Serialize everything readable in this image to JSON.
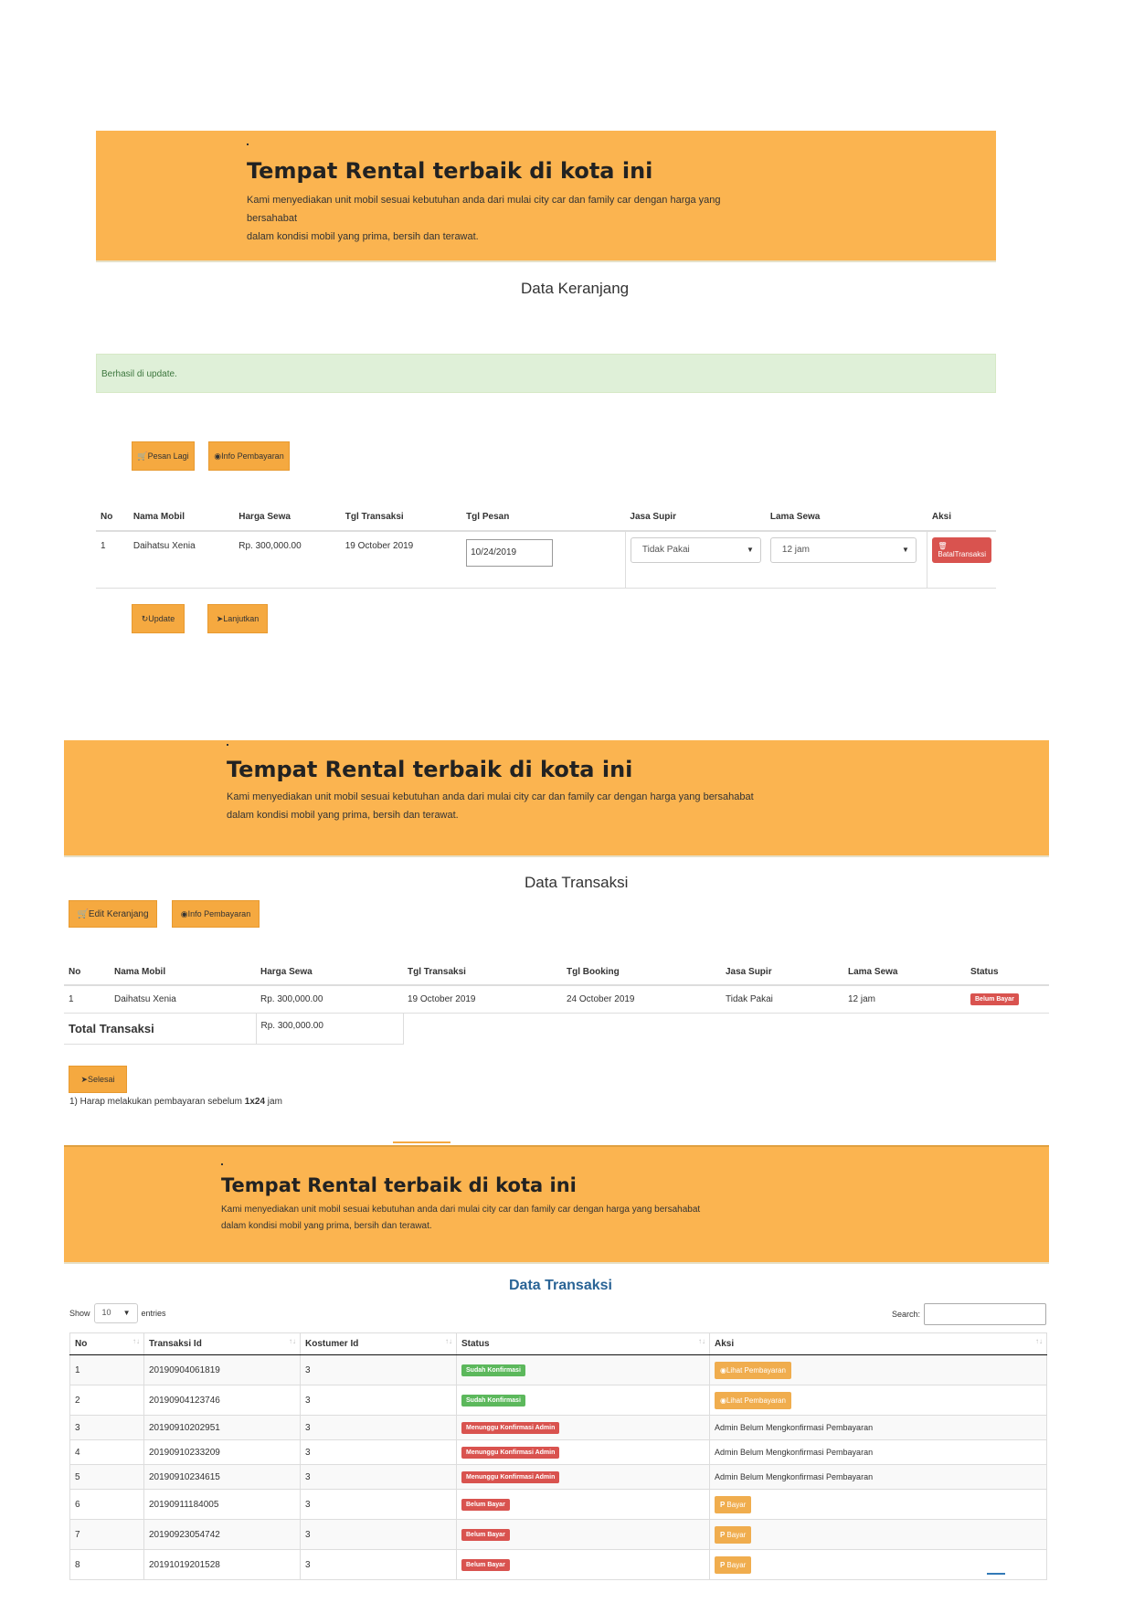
{
  "jumbotron": {
    "title": "Tempat Rental terbaik di kota ini",
    "line1": "Kami menyediakan unit mobil sesuai kebutuhan anda dari mulai city car dan family car dengan harga yang bersahabat",
    "line2": "dalam kondisi mobil yang prima, bersih dan terawat."
  },
  "cart": {
    "title": "Data Keranjang",
    "alert": "Berhasil di update.",
    "buttons": {
      "pesan_lagi": "Pesan Lagi",
      "info_pembayaran": "Info Pembayaran",
      "update": "Update",
      "lanjutkan": "Lanjutkan"
    },
    "columns": [
      "No",
      "Nama Mobil",
      "Harga Sewa",
      "Tgl Transaksi",
      "Tgl Pesan",
      "Jasa Supir",
      "Lama Sewa",
      "Aksi"
    ],
    "row": {
      "no": "1",
      "nama_mobil": "Daihatsu Xenia",
      "harga_sewa": "Rp. 300,000.00",
      "tgl_transaksi": "19 October 2019",
      "tgl_pesan": "10/24/2019",
      "jasa_supir": "Tidak Pakai",
      "lama_sewa": "12 jam",
      "aksi": "BatalTransaksi"
    }
  },
  "transaksi": {
    "title": "Data Transaksi",
    "buttons": {
      "edit_keranjang": "Edit Keranjang",
      "info_pembayaran": "Info Pembayaran",
      "selesai": "Selesai"
    },
    "columns": [
      "No",
      "Nama Mobil",
      "Harga Sewa",
      "Tgl Transaksi",
      "Tgl Booking",
      "Jasa Supir",
      "Lama Sewa",
      "Status"
    ],
    "row": {
      "no": "1",
      "nama_mobil": "Daihatsu Xenia",
      "harga_sewa": "Rp. 300,000.00",
      "tgl_transaksi": "19 October 2019",
      "tgl_booking": "24 October 2019",
      "jasa_supir": "Tidak Pakai",
      "lama_sewa": "12 jam",
      "status": "Belum Bayar"
    },
    "total_label": "Total Transaksi",
    "total_value": "Rp. 300,000.00",
    "note_prefix": "1) Harap melakukan pembayaran sebelum ",
    "note_bold": "1x24",
    "note_suffix": " jam"
  },
  "list": {
    "title": "Data Transaksi",
    "show_label": "Show",
    "entries_value": "10",
    "entries_label": "entries",
    "search_label": "Search:",
    "search_value": "",
    "columns": [
      "No",
      "Transaksi Id",
      "Kostumer Id",
      "Status",
      "Aksi"
    ],
    "rows": [
      {
        "no": "1",
        "transaksi_id": "20190904061819",
        "kostumer_id": "3",
        "status": "Sudah Konfirmasi",
        "aksi": "Lihat Pembayaran"
      },
      {
        "no": "2",
        "transaksi_id": "20190904123746",
        "kostumer_id": "3",
        "status": "Sudah Konfirmasi",
        "aksi": "Lihat Pembayaran"
      },
      {
        "no": "3",
        "transaksi_id": "20190910202951",
        "kostumer_id": "3",
        "status": "Menunggu Konfirmasi Admin",
        "aksi": "Admin Belum Mengkonfirmasi Pembayaran"
      },
      {
        "no": "4",
        "transaksi_id": "20190910233209",
        "kostumer_id": "3",
        "status": "Menunggu Konfirmasi Admin",
        "aksi": "Admin Belum Mengkonfirmasi Pembayaran"
      },
      {
        "no": "5",
        "transaksi_id": "20190910234615",
        "kostumer_id": "3",
        "status": "Menunggu Konfirmasi Admin",
        "aksi": "Admin Belum Mengkonfirmasi Pembayaran"
      },
      {
        "no": "6",
        "transaksi_id": "20190911184005",
        "kostumer_id": "3",
        "status": "Belum Bayar",
        "aksi": "Bayar"
      },
      {
        "no": "7",
        "transaksi_id": "20190923054742",
        "kostumer_id": "3",
        "status": "Belum Bayar",
        "aksi": "Bayar"
      },
      {
        "no": "8",
        "transaksi_id": "20191019201528",
        "kostumer_id": "3",
        "status": "Belum Bayar",
        "aksi": "Bayar"
      }
    ]
  },
  "colors": {
    "jumbotron": "#fbb450",
    "button_orange": "#f5a940",
    "danger": "#d9534f",
    "success": "#5cb85c",
    "title_blue": "#2a6496"
  }
}
